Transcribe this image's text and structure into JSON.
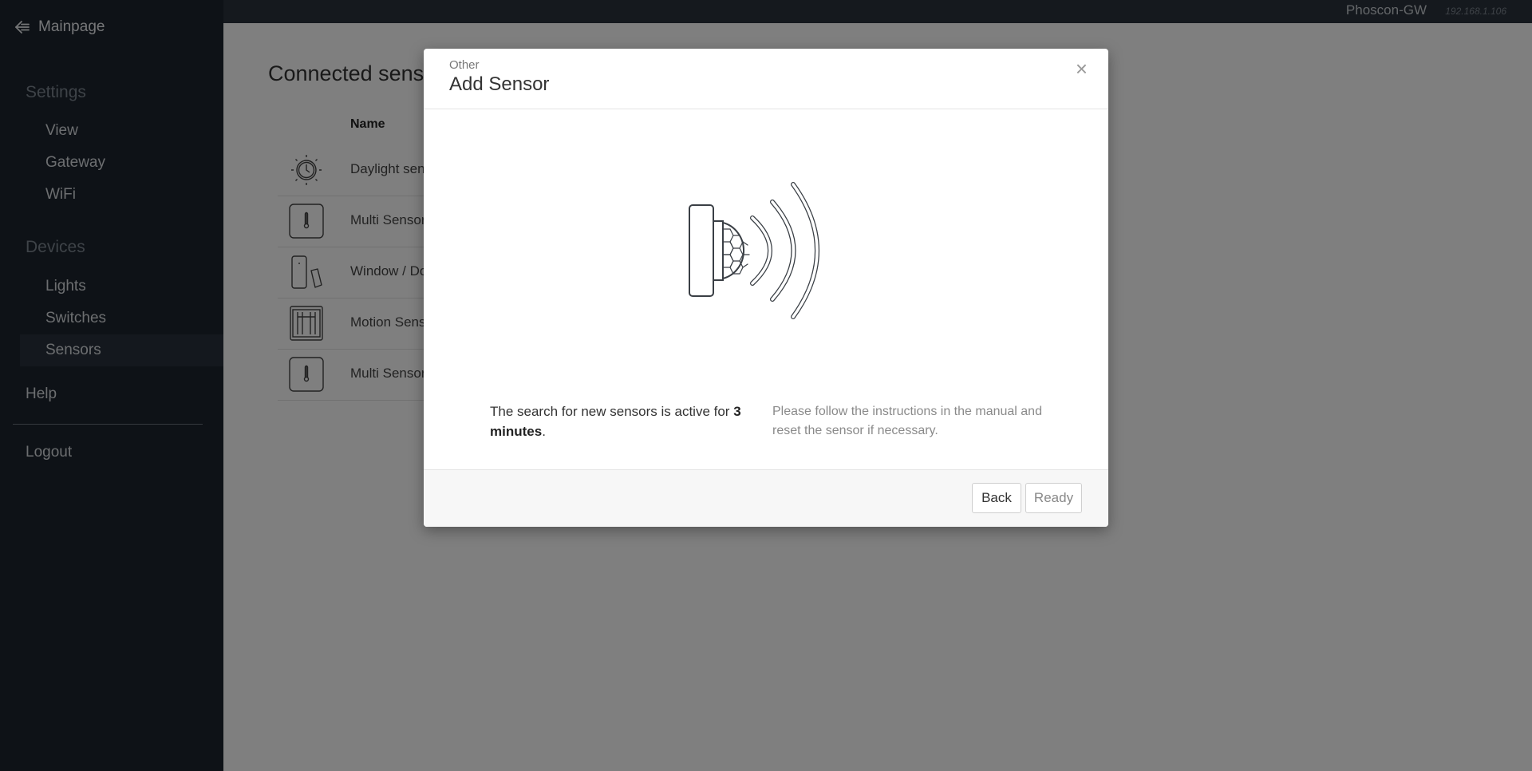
{
  "sidebar": {
    "mainpage_label": "Mainpage",
    "settings_title": "Settings",
    "settings_items": [
      {
        "label": "View"
      },
      {
        "label": "Gateway"
      },
      {
        "label": "WiFi"
      }
    ],
    "devices_title": "Devices",
    "devices_items": [
      {
        "label": "Lights"
      },
      {
        "label": "Switches"
      },
      {
        "label": "Sensors",
        "active": true
      }
    ],
    "help_label": "Help",
    "logout_label": "Logout"
  },
  "topbar": {
    "gateway_name": "Phoscon-GW",
    "gateway_ip": "192.168.1.106"
  },
  "page": {
    "title": "Connected sensors",
    "column_name": "Name",
    "rows": [
      {
        "name": "Daylight sensor",
        "icon": "daylight-clock-icon"
      },
      {
        "name": "Multi Sensor",
        "icon": "thermometer-icon"
      },
      {
        "name": "Window / Door",
        "icon": "door-window-sensor-icon"
      },
      {
        "name": "Motion Sensor",
        "icon": "motion-sensor-icon"
      },
      {
        "name": "Multi Sensor",
        "icon": "thermometer-icon"
      }
    ]
  },
  "modal": {
    "subtitle": "Other",
    "title": "Add Sensor",
    "close_label": "×",
    "illustration_icon": "motion-sensor-signal-icon",
    "search_text_prefix": "The search for new sensors is active for",
    "search_duration": "3 minutes",
    "search_text_suffix": ".",
    "instructions": "Please follow the instructions in the manual and reset the sensor if necessary.",
    "back_label": "Back",
    "ready_label": "Ready"
  },
  "colors": {
    "sidebar_bg": "#1d252f",
    "topbar_bg": "#2a323c",
    "active_item_bg": "#28313c",
    "overlay": "rgba(0,0,0,0.5)"
  }
}
